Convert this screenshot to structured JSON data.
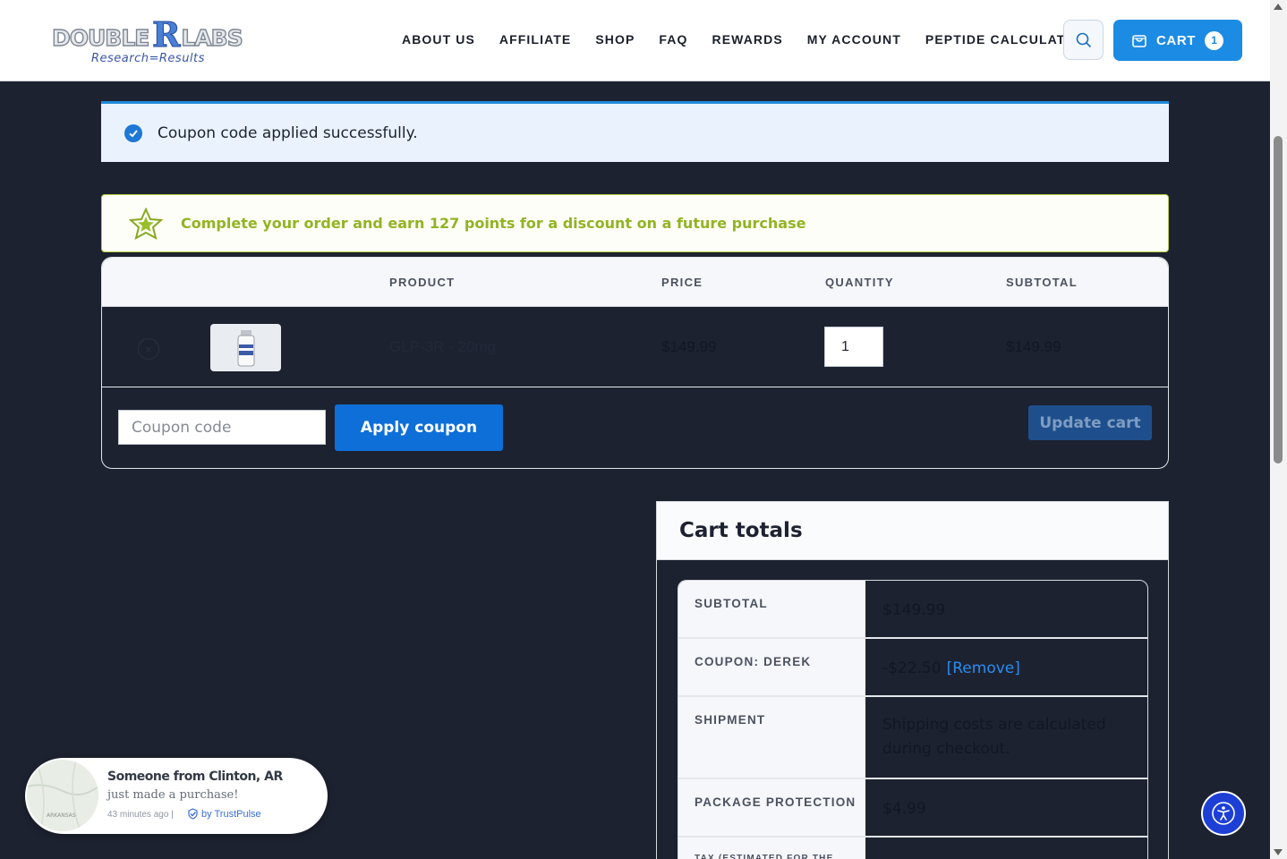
{
  "header": {
    "logo_text": "DOUBLE",
    "logo_r": "R",
    "logo_text2": "LABS",
    "logo_tagline": "Research=Results",
    "nav": [
      "ABOUT US",
      "AFFILIATE",
      "SHOP",
      "FAQ",
      "REWARDS",
      "MY ACCOUNT",
      "PEPTIDE CALCULATOR"
    ],
    "cart_label": "CART",
    "cart_count": "1"
  },
  "notice": {
    "text": "Coupon code applied successfully."
  },
  "points_banner": {
    "text": "Complete your order and earn 127 points for a discount on a future purchase"
  },
  "cart": {
    "headers": {
      "product": "PRODUCT",
      "price": "PRICE",
      "quantity": "QUANTITY",
      "subtotal": "SUBTOTAL"
    },
    "items": [
      {
        "name": "GLP-3R - 20mg",
        "price": "$149.99",
        "quantity": "1",
        "subtotal": "$149.99"
      }
    ],
    "coupon_placeholder": "Coupon code",
    "apply_label": "Apply coupon",
    "update_label": "Update cart"
  },
  "totals": {
    "title": "Cart totals",
    "rows": [
      {
        "label": "SUBTOTAL",
        "value": "$149.99"
      },
      {
        "label": "COUPON: DEREK",
        "value": "-$22.50",
        "link": "[Remove]"
      },
      {
        "label": "SHIPMENT",
        "value": "Shipping costs are calculated during checkout."
      },
      {
        "label": "PACKAGE PROTECTION",
        "value": "$4.99"
      },
      {
        "label": "TAX (ESTIMATED FOR THE",
        "value": ""
      }
    ]
  },
  "trustpulse": {
    "who": "Someone from Clinton, AR",
    "what": "just made a purchase!",
    "time": "43 minutes ago |",
    "by": "by TrustPulse",
    "map_label": "ARKANSAS"
  },
  "colors": {
    "accent": "#1c8be3",
    "page_bg": "#1d2230",
    "points_green": "#92b423"
  }
}
